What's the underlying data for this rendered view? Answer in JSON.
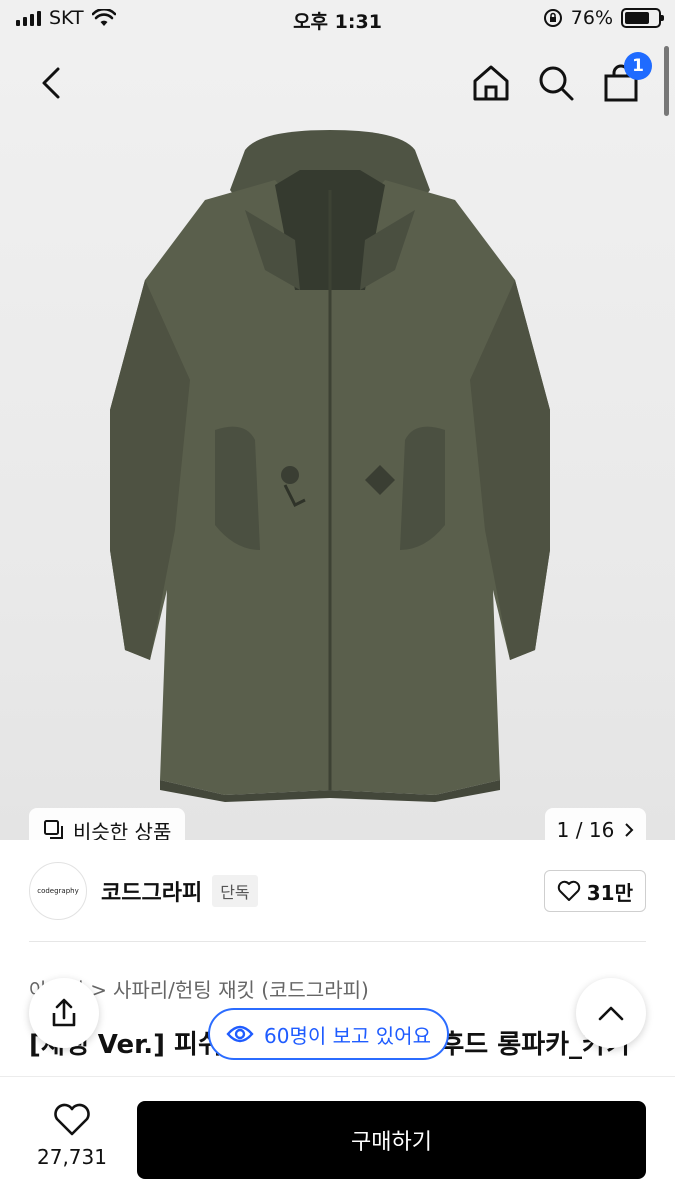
{
  "status_bar": {
    "carrier": "SKT",
    "time": "오후 1:31",
    "battery": "76%",
    "battery_level": 0.76
  },
  "nav": {
    "cart_count": "1",
    "icons": [
      "back-icon",
      "home-icon",
      "search-icon",
      "shopping-bag-icon"
    ]
  },
  "gallery": {
    "similar_label": "비슷한 상품",
    "pager": "1 / 16"
  },
  "brand": {
    "logo_text": "codegraphy",
    "name": "코드그라피",
    "exclusive": "단독",
    "likes": "31만"
  },
  "breadcrumb": {
    "parent": "아우터",
    "category": "사파리/헌팅 재킷 (코드그라피)"
  },
  "product": {
    "title": "[재생 Ver.] 피쉬테일 오버핏 하이넥 후드 롱파카_카키"
  },
  "viewers": {
    "text": "60명이 보고 있어요"
  },
  "bottom": {
    "wish_count": "27,731",
    "buy_label": "구매하기"
  }
}
